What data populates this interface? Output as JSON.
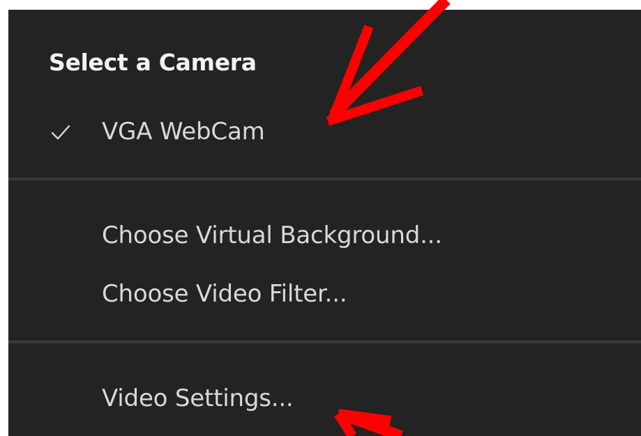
{
  "menu": {
    "header": "Select a Camera",
    "camera_item": {
      "label": "VGA WebCam",
      "checked": true,
      "check_icon": "checkmark-icon"
    },
    "virtual_background_label": "Choose Virtual Background...",
    "video_filter_label": "Choose Video Filter...",
    "video_settings_label": "Video Settings..."
  },
  "colors": {
    "menu_background": "#232323",
    "menu_text": "#d9d9d9",
    "header_text": "#f2f2f2",
    "divider": "#3a3a3a",
    "annotation_arrow": "#ff0000"
  }
}
